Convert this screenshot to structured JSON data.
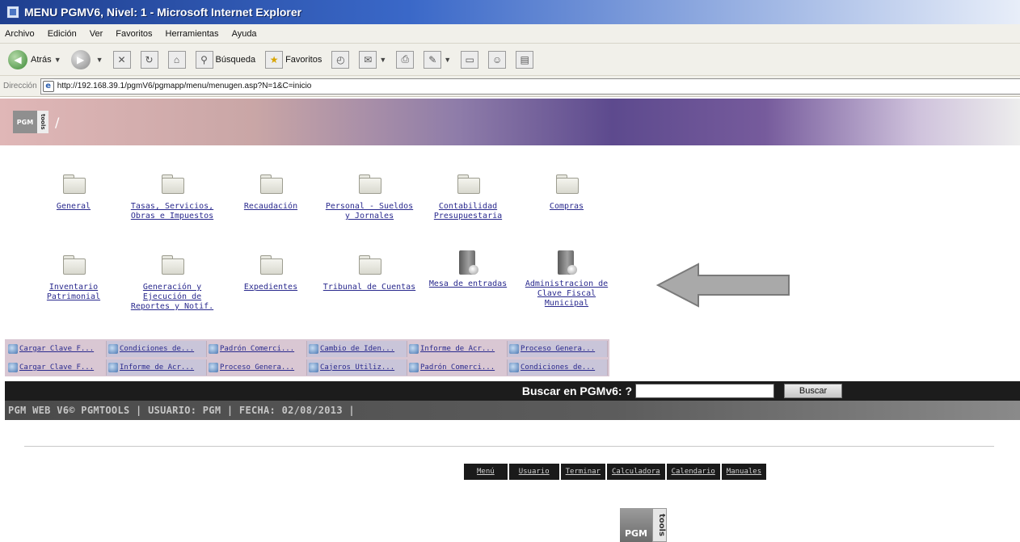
{
  "window": {
    "title": "MENU PGMV6, Nivel: 1 - Microsoft Internet Explorer"
  },
  "menubar": {
    "items": [
      "Archivo",
      "Edición",
      "Ver",
      "Favoritos",
      "Herramientas",
      "Ayuda"
    ]
  },
  "toolbar": {
    "back_label": "Atrás",
    "search_label": "Búsqueda",
    "favorites_label": "Favoritos"
  },
  "address": {
    "label": "Dirección",
    "url": "http://192.168.39.1/pgmV6/pgmapp/menu/menugen.asp?N=1&C=inicio"
  },
  "header": {
    "logo_pgm": "PGM",
    "logo_tools": "tools",
    "breadcrumb": "/"
  },
  "menu": {
    "row1": [
      "General",
      "Tasas, Servicios, Obras e Impuestos",
      "Recaudación",
      "Personal - Sueldos y Jornales",
      "Contabilidad Presupuestaria",
      "Compras"
    ],
    "row2": [
      "Inventario Patrimonial",
      "Generación y Ejecución de Reportes y Notif.",
      "Expedientes",
      "Tribunal de Cuentas",
      "Mesa de entradas",
      "Administracion de Clave Fiscal Municipal"
    ]
  },
  "shortcuts": {
    "row1": [
      "Cargar Clave F...",
      "Condiciones de...",
      "Padrón Comerci...",
      "Cambio de Iden...",
      "Informe de Acr...",
      "Proceso Genera..."
    ],
    "row2": [
      "Cargar Clave F...",
      "Informe de Acr...",
      "Proceso Genera...",
      "Cajeros Utiliz...",
      "Padrón Comerci...",
      "Condiciones de..."
    ]
  },
  "search": {
    "label": "Buscar en PGMv6: ?",
    "button": "Buscar"
  },
  "status": {
    "text": "PGM WEB V6© PGMTOOLS  | USUARIO: PGM | FECHA: 02/08/2013 |"
  },
  "footer": {
    "links": [
      "Menú",
      "Usuario",
      "Terminar",
      "Calculadora",
      "Calendario",
      "Manuales"
    ],
    "logo_pgm": "PGM",
    "logo_tools": "tools"
  },
  "colors": {
    "link": "#2a2a8e",
    "search_bar": "#1c1c1c",
    "arrow": "#9a9a9a"
  }
}
